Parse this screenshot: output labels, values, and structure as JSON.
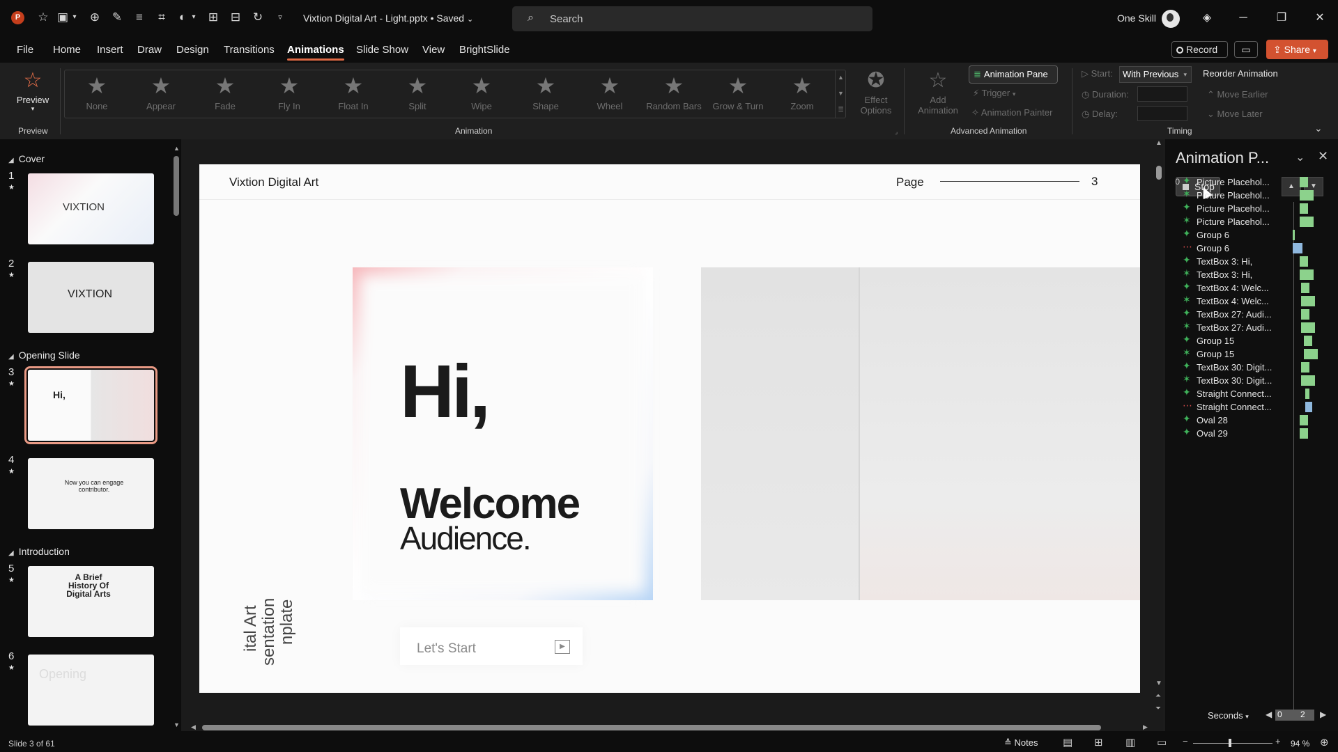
{
  "titlebar": {
    "doc_title": "Vixtion Digital Art - Light.pptx • Saved",
    "search_placeholder": "Search",
    "user_name": "One Skill"
  },
  "menu": {
    "tabs": [
      "File",
      "Home",
      "Insert",
      "Draw",
      "Design",
      "Transitions",
      "Animations",
      "Slide Show",
      "View",
      "BrightSlide"
    ],
    "active_tab": "Animations",
    "record_label": "Record",
    "share_label": "Share"
  },
  "ribbon": {
    "preview_label": "Preview",
    "preview_group": "Preview",
    "animation_group": "Animation",
    "gallery": [
      "None",
      "Appear",
      "Fade",
      "Fly In",
      "Float In",
      "Split",
      "Wipe",
      "Shape",
      "Wheel",
      "Random Bars",
      "Grow & Turn",
      "Zoom"
    ],
    "effect_options_line1": "Effect",
    "effect_options_line2": "Options",
    "add_animation_line1": "Add",
    "add_animation_line2": "Animation",
    "animation_pane_label": "Animation Pane",
    "trigger_label": "Trigger",
    "animation_painter_label": "Animation Painter",
    "advanced_group": "Advanced Animation",
    "start_label": "Start:",
    "start_value": "With Previous",
    "duration_label": "Duration:",
    "delay_label": "Delay:",
    "reorder_label": "Reorder Animation",
    "move_earlier_label": "Move Earlier",
    "move_later_label": "Move Later",
    "timing_group": "Timing"
  },
  "thumbnails": {
    "sections": [
      "Cover",
      "Opening Slide",
      "Introduction"
    ],
    "slides": [
      {
        "num": "1",
        "text": "VIXTION"
      },
      {
        "num": "2",
        "text": "VIXTION"
      },
      {
        "num": "3",
        "text": "Hi,"
      },
      {
        "num": "4",
        "text": "Now you can engage contributor."
      },
      {
        "num": "5",
        "text": "A Brief History Of Digital Arts"
      },
      {
        "num": "6",
        "text": "Opening"
      }
    ]
  },
  "slide": {
    "brand": "Vixtion Digital Art",
    "page_label": "Page",
    "page_number": "3",
    "hi": "Hi,",
    "welcome": "Welcome",
    "audience": "Audience.",
    "vertical_1": "ital Art",
    "vertical_2": "sentation",
    "vertical_3": "nplate",
    "start_button": "Let's Start"
  },
  "anim_pane": {
    "title": "Animation P...",
    "stop_label": "Stop",
    "first_index": "0",
    "items": [
      {
        "label": "Picture Placehol...",
        "type": "entrance"
      },
      {
        "label": "Picture Placehol...",
        "type": "motion"
      },
      {
        "label": "Picture Placehol...",
        "type": "entrance"
      },
      {
        "label": "Picture Placehol...",
        "type": "motion"
      },
      {
        "label": "Group 6",
        "type": "entrance"
      },
      {
        "label": "Group 6",
        "type": "exit"
      },
      {
        "label": "TextBox 3: Hi,",
        "type": "entrance"
      },
      {
        "label": "TextBox 3: Hi,",
        "type": "motion"
      },
      {
        "label": "TextBox 4: Welc...",
        "type": "entrance"
      },
      {
        "label": "TextBox 4: Welc...",
        "type": "motion"
      },
      {
        "label": "TextBox 27: Audi...",
        "type": "entrance"
      },
      {
        "label": "TextBox 27: Audi...",
        "type": "motion"
      },
      {
        "label": "Group 15",
        "type": "entrance"
      },
      {
        "label": "Group 15",
        "type": "motion"
      },
      {
        "label": "TextBox 30: Digit...",
        "type": "entrance"
      },
      {
        "label": "TextBox 30: Digit...",
        "type": "motion"
      },
      {
        "label": "Straight Connect...",
        "type": "entrance"
      },
      {
        "label": "Straight Connect...",
        "type": "exit"
      },
      {
        "label": "Oval 28",
        "type": "entrance"
      },
      {
        "label": "Oval 29",
        "type": "entrance"
      }
    ],
    "seconds_label": "Seconds",
    "scale_start": "0",
    "scale_end": "2"
  },
  "status": {
    "slide_counter": "Slide 3 of 61",
    "notes_label": "Notes",
    "zoom": "94 %"
  }
}
